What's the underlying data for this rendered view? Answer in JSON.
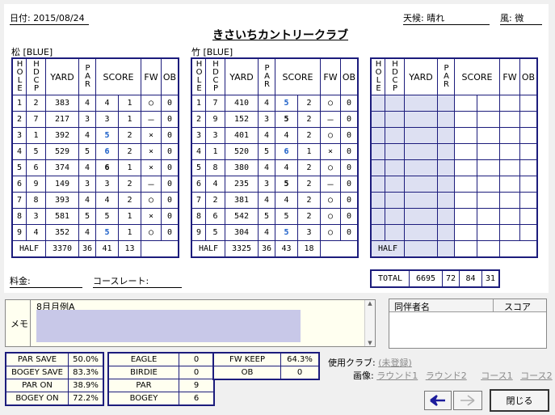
{
  "header": {
    "date_label": "日付: 2015/08/24",
    "weather_label": "天候: 晴れ",
    "wind_label": "風: 微",
    "course_name": "きさいちカントリークラブ"
  },
  "columns": {
    "hole": "HOLE",
    "hdcp": "HDCP",
    "yard": "YARD",
    "par": "PAR",
    "score": "SCORE",
    "fw": "FW",
    "ob": "OB"
  },
  "out": {
    "label": "松 [BLUE]",
    "holes": [
      {
        "hole": "1",
        "hdcp": "2",
        "yard": "383",
        "par": "4",
        "score": "4",
        "putt": "1",
        "fw": "○",
        "ob": "0",
        "style": ""
      },
      {
        "hole": "2",
        "hdcp": "7",
        "yard": "217",
        "par": "3",
        "score": "3",
        "putt": "1",
        "fw": "－",
        "ob": "0",
        "style": ""
      },
      {
        "hole": "3",
        "hdcp": "1",
        "yard": "392",
        "par": "4",
        "score": "5",
        "putt": "2",
        "fw": "×",
        "ob": "0",
        "style": "blue"
      },
      {
        "hole": "4",
        "hdcp": "5",
        "yard": "529",
        "par": "5",
        "score": "6",
        "putt": "2",
        "fw": "×",
        "ob": "0",
        "style": "blue"
      },
      {
        "hole": "5",
        "hdcp": "6",
        "yard": "374",
        "par": "4",
        "score": "6",
        "putt": "1",
        "fw": "×",
        "ob": "0",
        "style": "bold"
      },
      {
        "hole": "6",
        "hdcp": "9",
        "yard": "149",
        "par": "3",
        "score": "3",
        "putt": "2",
        "fw": "－",
        "ob": "0",
        "style": ""
      },
      {
        "hole": "7",
        "hdcp": "8",
        "yard": "393",
        "par": "4",
        "score": "4",
        "putt": "2",
        "fw": "○",
        "ob": "0",
        "style": ""
      },
      {
        "hole": "8",
        "hdcp": "3",
        "yard": "581",
        "par": "5",
        "score": "5",
        "putt": "1",
        "fw": "×",
        "ob": "0",
        "style": ""
      },
      {
        "hole": "9",
        "hdcp": "4",
        "yard": "352",
        "par": "4",
        "score": "5",
        "putt": "1",
        "fw": "○",
        "ob": "0",
        "style": "blue"
      }
    ],
    "half_label": "HALF",
    "half_yard": "3370",
    "half_par": "36",
    "half_score": "41",
    "half_putt": "13"
  },
  "in": {
    "label": "竹 [BLUE]",
    "holes": [
      {
        "hole": "1",
        "hdcp": "7",
        "yard": "410",
        "par": "4",
        "score": "5",
        "putt": "2",
        "fw": "○",
        "ob": "0",
        "style": "blue"
      },
      {
        "hole": "2",
        "hdcp": "9",
        "yard": "152",
        "par": "3",
        "score": "5",
        "putt": "2",
        "fw": "－",
        "ob": "0",
        "style": "bold"
      },
      {
        "hole": "3",
        "hdcp": "3",
        "yard": "401",
        "par": "4",
        "score": "4",
        "putt": "2",
        "fw": "○",
        "ob": "0",
        "style": ""
      },
      {
        "hole": "4",
        "hdcp": "1",
        "yard": "520",
        "par": "5",
        "score": "6",
        "putt": "1",
        "fw": "×",
        "ob": "0",
        "style": "blue"
      },
      {
        "hole": "5",
        "hdcp": "8",
        "yard": "380",
        "par": "4",
        "score": "4",
        "putt": "2",
        "fw": "○",
        "ob": "0",
        "style": ""
      },
      {
        "hole": "6",
        "hdcp": "4",
        "yard": "235",
        "par": "3",
        "score": "5",
        "putt": "2",
        "fw": "－",
        "ob": "0",
        "style": "bold"
      },
      {
        "hole": "7",
        "hdcp": "2",
        "yard": "381",
        "par": "4",
        "score": "4",
        "putt": "2",
        "fw": "○",
        "ob": "0",
        "style": ""
      },
      {
        "hole": "8",
        "hdcp": "6",
        "yard": "542",
        "par": "5",
        "score": "5",
        "putt": "2",
        "fw": "○",
        "ob": "0",
        "style": ""
      },
      {
        "hole": "9",
        "hdcp": "5",
        "yard": "304",
        "par": "4",
        "score": "5",
        "putt": "3",
        "fw": "○",
        "ob": "0",
        "style": "blue"
      }
    ],
    "half_label": "HALF",
    "half_yard": "3325",
    "half_par": "36",
    "half_score": "43",
    "half_putt": "18"
  },
  "third": {
    "half_label": "HALF"
  },
  "total": {
    "label": "TOTAL",
    "yard": "6695",
    "par": "72",
    "score": "84",
    "putt": "31"
  },
  "fees": {
    "fee_label": "料金:",
    "rating_label": "コースレート:"
  },
  "memo": {
    "label": "メモ",
    "text": "8月月例A"
  },
  "companions": {
    "name_header": "同伴者名",
    "score_header": "スコア"
  },
  "stats_a": [
    {
      "label": "PAR SAVE",
      "value": "50.0%"
    },
    {
      "label": "BOGEY SAVE",
      "value": "83.3%"
    },
    {
      "label": "PAR ON",
      "value": "38.9%"
    },
    {
      "label": "BOGEY ON",
      "value": "72.2%"
    }
  ],
  "stats_b": [
    {
      "label": "EAGLE",
      "value": "0"
    },
    {
      "label": "BIRDIE",
      "value": "0"
    },
    {
      "label": "PAR",
      "value": "9"
    },
    {
      "label": "BOGEY",
      "value": "6"
    }
  ],
  "stats_c": [
    {
      "label": "FW KEEP",
      "value": "64.3%"
    },
    {
      "label": "OB",
      "value": "0"
    }
  ],
  "club": {
    "label": "使用クラブ:",
    "link": "(未登録)"
  },
  "images": {
    "label": "画像:",
    "links": [
      "ラウンド1",
      "ラウンド2",
      "コース1",
      "コース2"
    ]
  },
  "buttons": {
    "close": "閉じる"
  },
  "colors": {
    "grid": "#1c1c7c",
    "score_over": "#1a5ec8",
    "empty_cell": "#dde0f2",
    "memo_fill": "#c8c8e8"
  }
}
